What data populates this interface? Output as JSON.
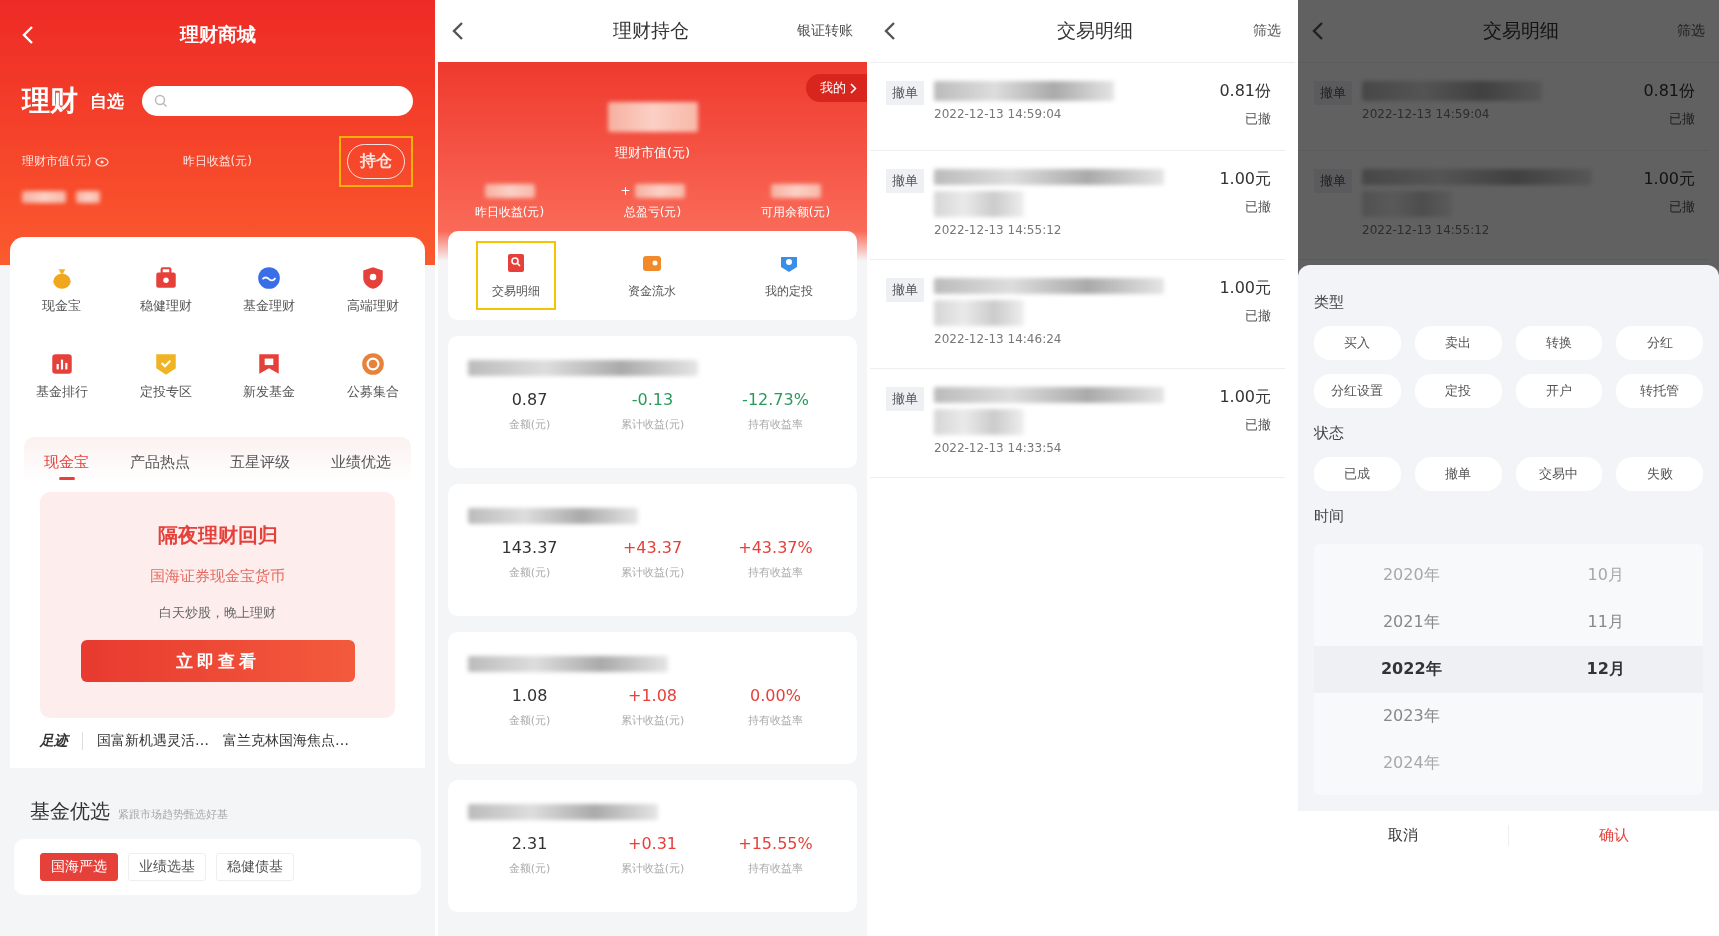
{
  "mall": {
    "title": "理财商城",
    "heading": "理财",
    "watchlist_tab": "自选",
    "market_value_label": "理财市值(元)",
    "yesterday_label": "昨日收益(元)",
    "holdings_button": {
      "label": "持仓",
      "highlighted": true
    },
    "shortcuts": [
      "现金宝",
      "稳健理财",
      "基金理财",
      "高端理财",
      "基金排行",
      "定投专区",
      "新发基金",
      "公募集合"
    ],
    "product_tabs": [
      {
        "label": "现金宝",
        "selected": true
      },
      {
        "label": "产品热点",
        "selected": false
      },
      {
        "label": "五星评级",
        "selected": false
      },
      {
        "label": "业绩优选",
        "selected": false
      }
    ],
    "promo": {
      "title": "隔夜理财回归",
      "subtitle": "国海证券现金宝货币",
      "slogan": "白天炒股，晚上理财",
      "button": "立即查看"
    },
    "footer": {
      "logo": "足迹",
      "links": [
        "国富新机遇灵活…",
        "富兰克林国海焦点…"
      ]
    },
    "section": {
      "title": "基金优选",
      "subtitle": "紧跟市场趋势甄选好基"
    },
    "fund_tabs": [
      {
        "label": "国海严选",
        "selected": true
      },
      {
        "label": "业绩选基",
        "selected": false
      },
      {
        "label": "稳健债基",
        "selected": false
      }
    ]
  },
  "holdings": {
    "title": "理财持仓",
    "transfer_link": "银证转账",
    "mine_button": "我的",
    "market_value_label": "理财市值(元)",
    "stats": [
      {
        "label": "昨日收益(元)"
      },
      {
        "label": "总盈亏(元)",
        "prefix": "+"
      },
      {
        "label": "可用余额(元)"
      }
    ],
    "actions": [
      {
        "label": "交易明细",
        "highlighted": true
      },
      {
        "label": "资金流水",
        "highlighted": false
      },
      {
        "label": "我的定投",
        "highlighted": false
      }
    ],
    "positions": [
      {
        "amount": "0.87",
        "amount_label": "金额(元)",
        "profit": "-0.13",
        "profit_label": "累计收益(元)",
        "rate": "-12.73%",
        "rate_label": "持有收益率",
        "color": "#2a9a5a"
      },
      {
        "amount": "143.37",
        "amount_label": "金额(元)",
        "profit": "+43.37",
        "profit_label": "累计收益(元)",
        "rate": "+43.37%",
        "rate_label": "持有收益率",
        "color": "#e6403a"
      },
      {
        "amount": "1.08",
        "amount_label": "金额(元)",
        "profit": "+1.08",
        "profit_label": "累计收益(元)",
        "rate": "0.00%",
        "rate_label": "持有收益率",
        "color": "#e6403a"
      },
      {
        "amount": "2.31",
        "amount_label": "金额(元)",
        "profit": "+0.31",
        "profit_label": "累计收益(元)",
        "rate": "+15.55%",
        "rate_label": "持有收益率",
        "color": "#e6403a"
      }
    ]
  },
  "transactions": {
    "title": "交易明细",
    "filter_link": "筛选",
    "rows": [
      {
        "tag": "撤单",
        "date": "2022-12-13 14:59:04",
        "amount": "0.81份",
        "status": "已撤"
      },
      {
        "tag": "撤单",
        "date": "2022-12-13 14:55:12",
        "amount": "1.00元",
        "status": "已撤"
      },
      {
        "tag": "撤单",
        "date": "2022-12-13 14:46:24",
        "amount": "1.00元",
        "status": "已撤"
      },
      {
        "tag": "撤单",
        "date": "2022-12-13 14:33:54",
        "amount": "1.00元",
        "status": "已撤"
      }
    ]
  },
  "filter_sheet": {
    "background": {
      "title": "交易明细",
      "filter_link": "筛选",
      "rows": [
        {
          "tag": "撤单",
          "date": "2022-12-13 14:59:04",
          "amount": "0.81份",
          "status": "已撤"
        },
        {
          "tag": "撤单",
          "date": "2022-12-13 14:55:12",
          "amount": "1.00元",
          "status": "已撤"
        }
      ]
    },
    "type_label": "类型",
    "types": [
      "买入",
      "卖出",
      "转换",
      "分红",
      "分红设置",
      "定投",
      "开户",
      "转托管"
    ],
    "status_label": "状态",
    "statuses": [
      "已成",
      "撤单",
      "交易中",
      "失败"
    ],
    "time_label": "时间",
    "years": [
      {
        "label": "2020年",
        "selected": false
      },
      {
        "label": "2021年",
        "selected": false
      },
      {
        "label": "2022年",
        "selected": true
      },
      {
        "label": "2023年",
        "selected": false
      },
      {
        "label": "2024年",
        "selected": false
      }
    ],
    "months": [
      {
        "label": "10月",
        "selected": false
      },
      {
        "label": "11月",
        "selected": false
      },
      {
        "label": "12月",
        "selected": true
      }
    ],
    "cancel": "取消",
    "confirm": "确认"
  }
}
